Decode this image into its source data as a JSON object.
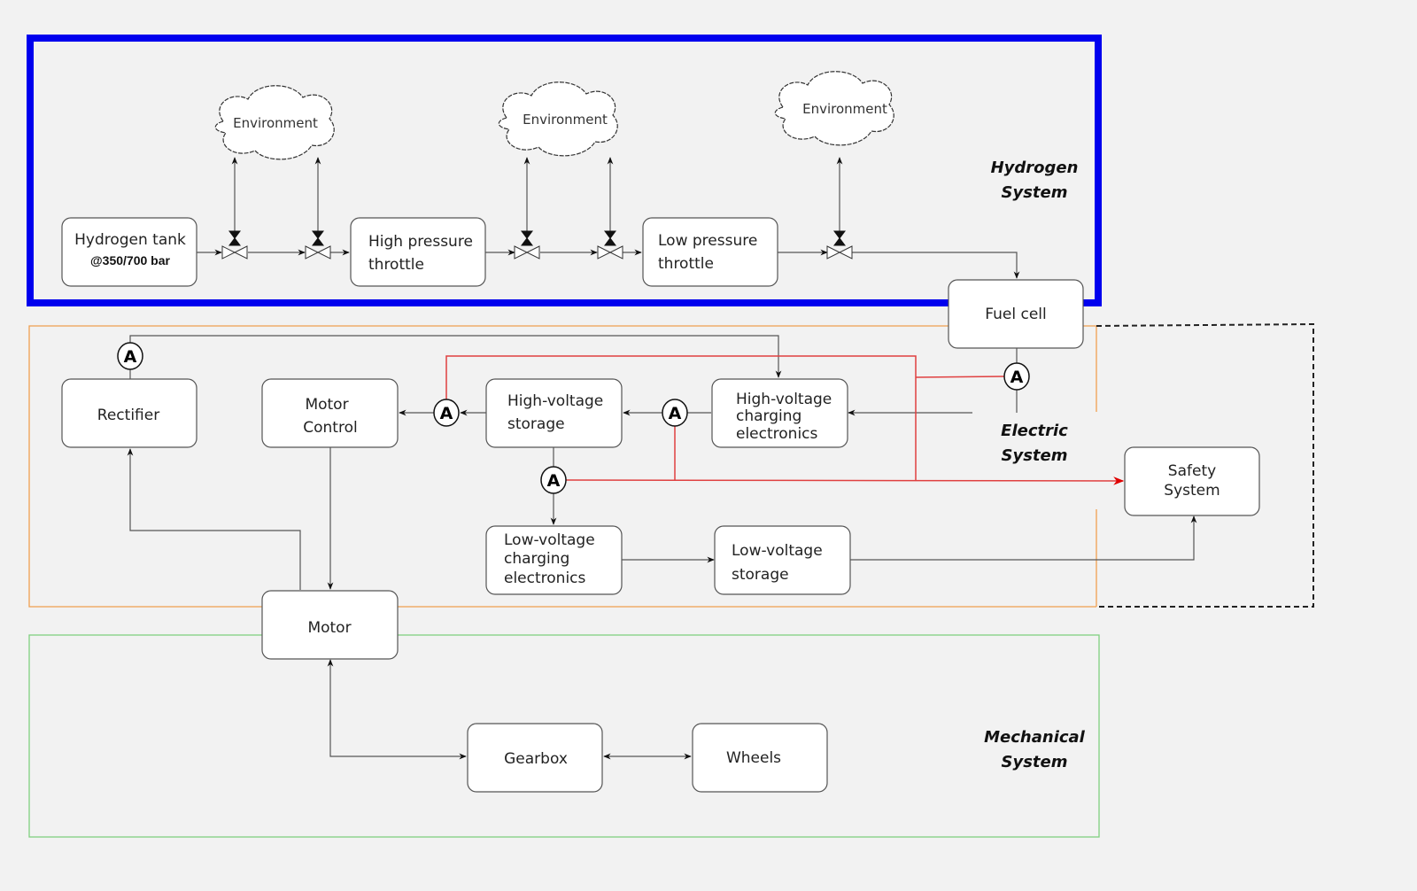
{
  "colors": {
    "background": "#f2f2f2",
    "hydrogen_system_border": "#0000ee",
    "electric_system_border": "#f0a050",
    "mechanical_system_border": "#80d080",
    "signal_line": "#e04040",
    "safety_boundary": "#222222"
  },
  "systems": {
    "hydrogen": {
      "label_line1": "Hydrogen",
      "label_line2": "System"
    },
    "electric": {
      "label_line1": "Electric",
      "label_line2": "System"
    },
    "mechanical": {
      "label_line1": "Mechanical",
      "label_line2": "System"
    }
  },
  "environment_label": "Environment",
  "ammeter_symbol": "A",
  "components": {
    "hydrogen_tank": {
      "line1": "Hydrogen tank",
      "line2": "@350/700 bar"
    },
    "high_pressure_throttle": {
      "line1": "High pressure",
      "line2": "throttle"
    },
    "low_pressure_throttle": {
      "line1": "Low pressure",
      "line2": "throttle"
    },
    "fuel_cell": {
      "line1": "Fuel cell"
    },
    "rectifier": {
      "line1": "Rectifier"
    },
    "motor_control": {
      "line1": "Motor",
      "line2": "Control"
    },
    "hv_storage": {
      "line1": "High-voltage",
      "line2": "storage"
    },
    "hv_charging": {
      "line1": "High-voltage",
      "line2": "charging",
      "line3": "electronics"
    },
    "safety_system": {
      "line1": "Safety",
      "line2": "System"
    },
    "lv_charging": {
      "line1": "Low-voltage",
      "line2": "charging",
      "line3": "electronics"
    },
    "lv_storage": {
      "line1": "Low-voltage",
      "line2": "storage"
    },
    "motor": {
      "line1": "Motor"
    },
    "gearbox": {
      "line1": "Gearbox"
    },
    "wheels": {
      "line1": "Wheels"
    }
  }
}
